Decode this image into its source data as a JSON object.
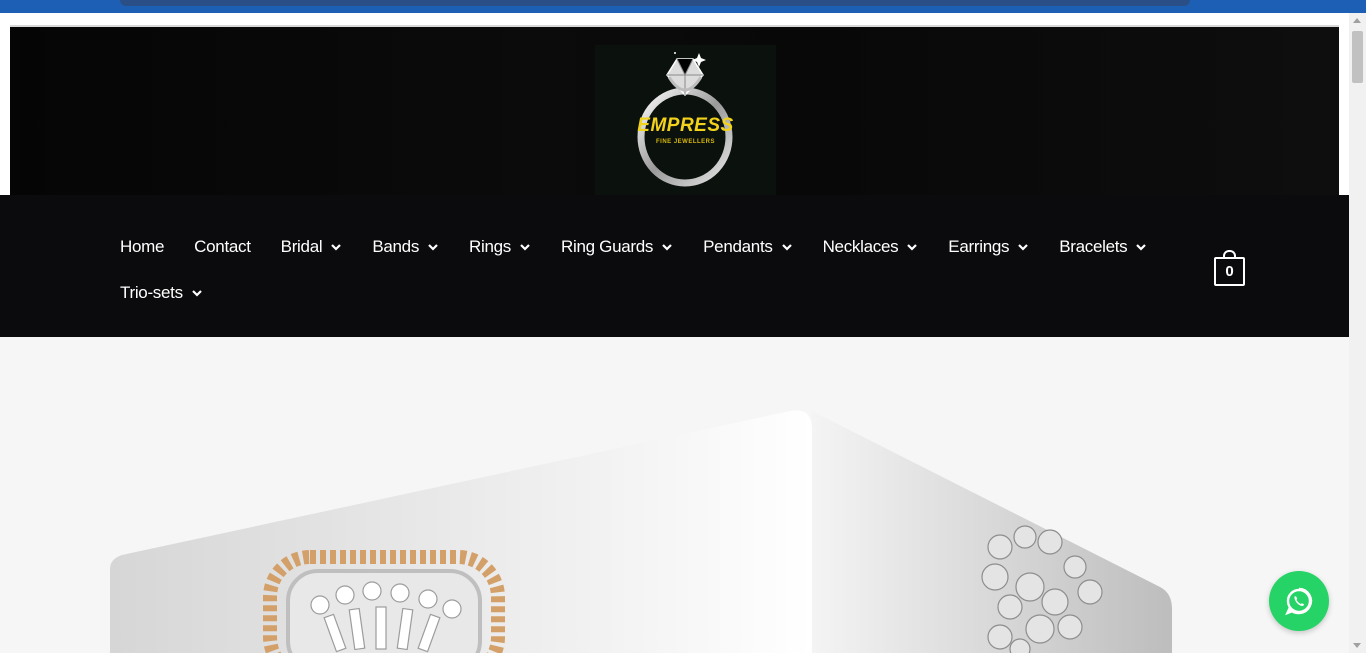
{
  "brand": {
    "logo_text": "EMPRESS",
    "logo_subtext": "FINE JEWELLERS"
  },
  "nav": {
    "row1": [
      {
        "label": "Home",
        "has_dropdown": false
      },
      {
        "label": "Contact",
        "has_dropdown": false
      },
      {
        "label": "Bridal",
        "has_dropdown": true
      },
      {
        "label": "Bands",
        "has_dropdown": true
      },
      {
        "label": "Rings",
        "has_dropdown": true
      },
      {
        "label": "Ring Guards",
        "has_dropdown": true
      },
      {
        "label": "Pendants",
        "has_dropdown": true
      },
      {
        "label": "Necklaces",
        "has_dropdown": true
      },
      {
        "label": "Earrings",
        "has_dropdown": true
      },
      {
        "label": "Bracelets",
        "has_dropdown": true
      }
    ],
    "row2": [
      {
        "label": "Trio-sets",
        "has_dropdown": true
      }
    ]
  },
  "cart": {
    "count": "0",
    "icon": "shopping-bag-icon"
  },
  "whatsapp": {
    "icon": "whatsapp-icon",
    "color": "#25d366"
  },
  "colors": {
    "header_bg": "#0b0b0d",
    "logo_gold": "#f2d21b",
    "hero_bg": "#f6f6f6"
  }
}
